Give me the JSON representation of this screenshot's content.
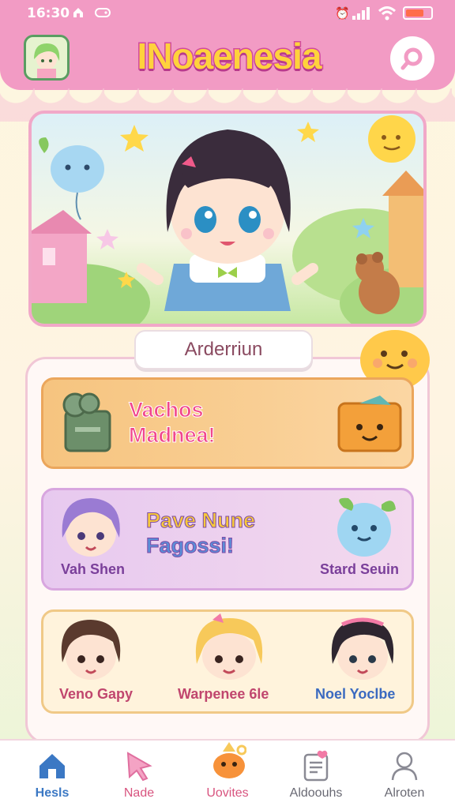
{
  "status_bar": {
    "time": "16:30"
  },
  "app": {
    "title": "INoaenesia"
  },
  "section": {
    "pill_label": "Arderriun"
  },
  "cards": [
    {
      "title_line1": "Vachos",
      "title_line2": "Madnea!"
    },
    {
      "title_line1": "Pave Nune",
      "title_line2": "Fagossi!",
      "left_name": "Vah Shen",
      "right_name": "Stard Seuin"
    },
    {
      "names": [
        "Veno Gapy",
        "Warpenee 6le",
        "Noel Yoclbe"
      ]
    }
  ],
  "nav": [
    {
      "label": "Hesls",
      "icon": "home-icon",
      "active": true
    },
    {
      "label": "Nade",
      "icon": "cursor-icon"
    },
    {
      "label": "Uovites",
      "icon": "mascot-icon"
    },
    {
      "label": "Aldoouhs",
      "icon": "notes-icon"
    },
    {
      "label": "Alroten",
      "icon": "person-icon"
    }
  ],
  "colors": {
    "appbar": "#f29bc4",
    "title": "#ffd23c",
    "nav_active": "#3b78c4"
  }
}
